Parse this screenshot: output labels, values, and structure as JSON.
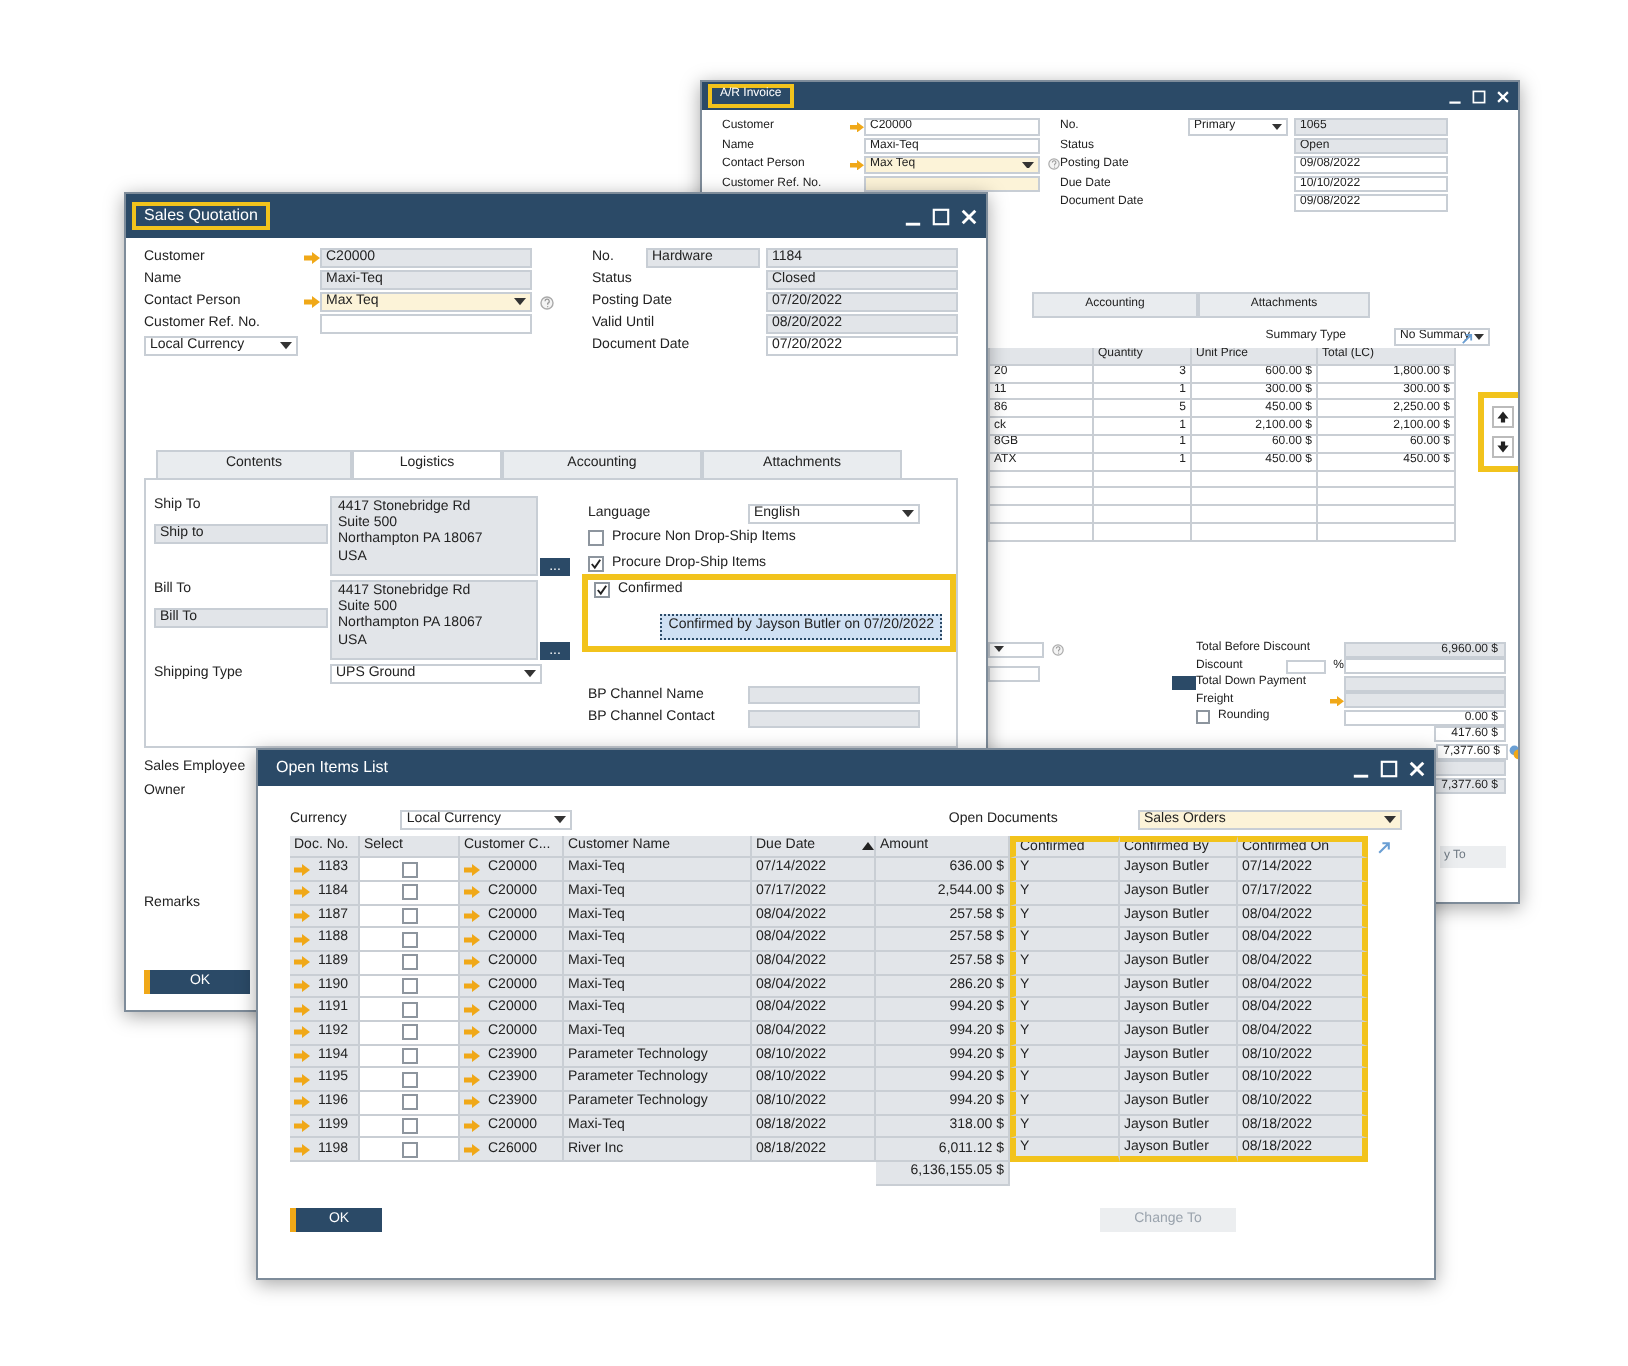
{
  "ar_invoice": {
    "title": "A/R Invoice",
    "title_highlighted": true,
    "header_left": [
      {
        "label": "Customer",
        "value": "C20000",
        "link": true,
        "kind": "input"
      },
      {
        "label": "Name",
        "value": "Maxi-Teq",
        "link": false,
        "kind": "input"
      },
      {
        "label": "Contact Person",
        "value": "Max Teq",
        "link": true,
        "kind": "dropdown"
      },
      {
        "label": "Customer Ref. No.",
        "link": false,
        "kind": "focused"
      }
    ],
    "header_right": [
      {
        "label": "No.",
        "series": "Primary",
        "value": "1065",
        "kind": "text"
      },
      {
        "label": "Status",
        "value": "Open",
        "kind": "text"
      },
      {
        "label": "Posting Date",
        "value": "09/08/2022",
        "kind": "input"
      },
      {
        "label": "Due Date",
        "value": "10/10/2022",
        "kind": "input"
      },
      {
        "label": "Document Date",
        "value": "09/08/2022",
        "kind": "input"
      }
    ],
    "tabs": [
      {
        "label": "Accounting",
        "selected": false
      },
      {
        "label": "Attachments",
        "selected": false
      }
    ],
    "summary_type": {
      "label": "Summary Type",
      "value": "No Summary"
    },
    "table": {
      "columns": [
        "Quantity",
        "Unit Price",
        "Total (LC)"
      ],
      "rows": [
        {
          "column_1": "20",
          "quantity": "3",
          "unit_price": "600.00 $",
          "total": "1,800.00 $"
        },
        {
          "column_1": "11",
          "quantity": "1",
          "unit_price": "300.00 $",
          "total": "300.00 $"
        },
        {
          "column_1": "86",
          "quantity": "5",
          "unit_price": "450.00 $",
          "total": "2,250.00 $"
        },
        {
          "column_1": "ck",
          "quantity": "1",
          "unit_price": "2,100.00 $",
          "total": "2,100.00 $"
        },
        {
          "column_1": "8GB",
          "quantity": "1",
          "unit_price": "60.00 $",
          "total": "60.00 $"
        },
        {
          "column_1": "ATX",
          "quantity": "1",
          "unit_price": "450.00 $",
          "total": "450.00 $"
        }
      ]
    },
    "row_buttons_highlighted": true,
    "totals": [
      {
        "label": "Total Before Discount",
        "value": "6,960.00 $",
        "kind": "text"
      },
      {
        "label": "Discount",
        "unit": "%",
        "kind": "percent"
      },
      {
        "label": "Total Down Payment",
        "kind": "button"
      },
      {
        "label": "Freight",
        "kind": "link"
      },
      {
        "label": "Rounding",
        "value": "0.00 $",
        "kind": "checkbox",
        "checked": false
      },
      {
        "value": "417.60 $",
        "kind": "plain"
      },
      {
        "value": "7,377.60 $",
        "kind": "icon"
      },
      {
        "kind": "blank"
      },
      {
        "value": "7,377.60 $",
        "kind": "text"
      }
    ],
    "change_to": "y To"
  },
  "sales_quotation": {
    "title": "Sales Quotation",
    "title_highlighted": true,
    "header_left": [
      {
        "label": "Customer",
        "value": "C20000",
        "link": true,
        "kind": "text"
      },
      {
        "label": "Name",
        "value": "Maxi-Teq",
        "link": false,
        "kind": "text"
      },
      {
        "label": "Contact Person",
        "value": "Max Teq",
        "link": true,
        "kind": "dropdown"
      },
      {
        "label": "Customer Ref. No.",
        "link": false,
        "kind": "input"
      },
      {
        "value": "Local Currency",
        "kind": "currency"
      }
    ],
    "header_right": [
      {
        "label": "No.",
        "series": "Hardware",
        "value": "1184",
        "kind": "text"
      },
      {
        "label": "Status",
        "value": "Closed",
        "kind": "text"
      },
      {
        "label": "Posting Date",
        "value": "07/20/2022",
        "kind": "text"
      },
      {
        "label": "Valid Until",
        "value": "08/20/2022",
        "kind": "text"
      },
      {
        "label": "Document Date",
        "value": "07/20/2022",
        "kind": "input"
      }
    ],
    "tabs": [
      {
        "label": "Contents",
        "selected": false
      },
      {
        "label": "Logistics",
        "selected": true
      },
      {
        "label": "Accounting",
        "selected": false
      },
      {
        "label": "Attachments",
        "selected": false
      }
    ],
    "addresses": [
      {
        "label": "Ship To",
        "name": "Ship to",
        "lines": [
          "4417 Stonebridge Rd",
          "Suite 500",
          "Northampton PA  18067",
          "USA"
        ],
        "button": "..."
      },
      {
        "label": "Bill To",
        "name": "Bill To",
        "lines": [
          "4417 Stonebridge Rd",
          "Suite 500",
          "Northampton PA  18067",
          "USA"
        ],
        "button": "..."
      }
    ],
    "shipping_type": {
      "label": "Shipping Type",
      "value": "UPS Ground"
    },
    "language": {
      "label": "Language",
      "value": "English"
    },
    "options": [
      {
        "label": "Procure Non Drop-Ship Items",
        "checked": false
      },
      {
        "label": "Procure Drop-Ship Items",
        "checked": true
      }
    ],
    "confirmation": {
      "label": "Confirmed",
      "checked": true,
      "note": "Confirmed by Jayson Butler on 07/20/2022",
      "highlighted": true
    },
    "bp_channel": [
      "BP Channel Name",
      "BP Channel Contact"
    ],
    "footer_labels": [
      "Sales Employee",
      "Owner"
    ],
    "remarks_label": "Remarks",
    "ok_button": "OK"
  },
  "open_items": {
    "title": "Open Items List",
    "currency": {
      "label": "Currency",
      "value": "Local Currency"
    },
    "open_documents": {
      "label": "Open Documents",
      "value": "Sales Orders"
    },
    "columns": [
      {
        "label": "Doc. No.",
        "highlighted": false
      },
      {
        "label": "Select",
        "highlighted": false
      },
      {
        "label": "Customer C...",
        "highlighted": false
      },
      {
        "label": "Customer Name",
        "highlighted": false
      },
      {
        "label": "Due Date",
        "highlighted": false,
        "sorted": true
      },
      {
        "label": "Amount",
        "highlighted": false
      },
      {
        "label": "Confirmed",
        "highlighted": true
      },
      {
        "label": "Confirmed By",
        "highlighted": true
      },
      {
        "label": "Confirmed On",
        "highlighted": true
      }
    ],
    "rows": [
      {
        "doc": "1183",
        "selected": false,
        "customer_code": "C20000",
        "customer_name": "Maxi-Teq",
        "due_date": "07/14/2022",
        "amount": "636.00 $",
        "confirmed": "Y",
        "confirmed_by": "Jayson Butler",
        "confirmed_on": "07/14/2022"
      },
      {
        "doc": "1184",
        "selected": false,
        "customer_code": "C20000",
        "customer_name": "Maxi-Teq",
        "due_date": "07/17/2022",
        "amount": "2,544.00 $",
        "confirmed": "Y",
        "confirmed_by": "Jayson Butler",
        "confirmed_on": "07/17/2022"
      },
      {
        "doc": "1187",
        "selected": false,
        "customer_code": "C20000",
        "customer_name": "Maxi-Teq",
        "due_date": "08/04/2022",
        "amount": "257.58 $",
        "confirmed": "Y",
        "confirmed_by": "Jayson Butler",
        "confirmed_on": "08/04/2022"
      },
      {
        "doc": "1188",
        "selected": false,
        "customer_code": "C20000",
        "customer_name": "Maxi-Teq",
        "due_date": "08/04/2022",
        "amount": "257.58 $",
        "confirmed": "Y",
        "confirmed_by": "Jayson Butler",
        "confirmed_on": "08/04/2022"
      },
      {
        "doc": "1189",
        "selected": false,
        "customer_code": "C20000",
        "customer_name": "Maxi-Teq",
        "due_date": "08/04/2022",
        "amount": "257.58 $",
        "confirmed": "Y",
        "confirmed_by": "Jayson Butler",
        "confirmed_on": "08/04/2022"
      },
      {
        "doc": "1190",
        "selected": false,
        "customer_code": "C20000",
        "customer_name": "Maxi-Teq",
        "due_date": "08/04/2022",
        "amount": "286.20 $",
        "confirmed": "Y",
        "confirmed_by": "Jayson Butler",
        "confirmed_on": "08/04/2022"
      },
      {
        "doc": "1191",
        "selected": false,
        "customer_code": "C20000",
        "customer_name": "Maxi-Teq",
        "due_date": "08/04/2022",
        "amount": "994.20 $",
        "confirmed": "Y",
        "confirmed_by": "Jayson Butler",
        "confirmed_on": "08/04/2022"
      },
      {
        "doc": "1192",
        "selected": false,
        "customer_code": "C20000",
        "customer_name": "Maxi-Teq",
        "due_date": "08/04/2022",
        "amount": "994.20 $",
        "confirmed": "Y",
        "confirmed_by": "Jayson Butler",
        "confirmed_on": "08/04/2022"
      },
      {
        "doc": "1194",
        "selected": false,
        "customer_code": "C23900",
        "customer_name": "Parameter Technology",
        "due_date": "08/10/2022",
        "amount": "994.20 $",
        "confirmed": "Y",
        "confirmed_by": "Jayson Butler",
        "confirmed_on": "08/10/2022"
      },
      {
        "doc": "1195",
        "selected": false,
        "customer_code": "C23900",
        "customer_name": "Parameter Technology",
        "due_date": "08/10/2022",
        "amount": "994.20 $",
        "confirmed": "Y",
        "confirmed_by": "Jayson Butler",
        "confirmed_on": "08/10/2022"
      },
      {
        "doc": "1196",
        "selected": false,
        "customer_code": "C23900",
        "customer_name": "Parameter Technology",
        "due_date": "08/10/2022",
        "amount": "994.20 $",
        "confirmed": "Y",
        "confirmed_by": "Jayson Butler",
        "confirmed_on": "08/10/2022"
      },
      {
        "doc": "1199",
        "selected": false,
        "customer_code": "C20000",
        "customer_name": "Maxi-Teq",
        "due_date": "08/18/2022",
        "amount": "318.00 $",
        "confirmed": "Y",
        "confirmed_by": "Jayson Butler",
        "confirmed_on": "08/18/2022"
      },
      {
        "doc": "1198",
        "selected": false,
        "customer_code": "C26000",
        "customer_name": "River Inc",
        "due_date": "08/18/2022",
        "amount": "6,011.12 $",
        "confirmed": "Y",
        "confirmed_by": "Jayson Butler",
        "confirmed_on": "08/18/2022"
      }
    ],
    "total": "6,136,155.05 $",
    "buttons": [
      {
        "label": "OK",
        "disabled": false
      },
      {
        "label": "Change To",
        "disabled": true
      }
    ]
  }
}
